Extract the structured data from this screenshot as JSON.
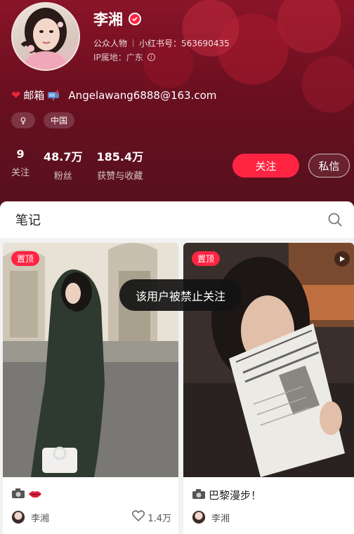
{
  "profile": {
    "name": "李湘",
    "category": "公众人物",
    "id_label": "小红书号：563690435",
    "ip_label": "IP属地：广东",
    "bio_text": "邮箱",
    "email": "Angelawang6888@163.com",
    "tags": [
      "♀",
      "中国"
    ]
  },
  "stats": [
    {
      "value": "9",
      "label": "关注"
    },
    {
      "value": "48.7万",
      "label": "粉丝"
    },
    {
      "value": "185.4万",
      "label": "获赞与收藏"
    }
  ],
  "actions": {
    "follow": "关注",
    "message": "私信"
  },
  "notes": {
    "section_title": "笔记",
    "cards": [
      {
        "pin": "置顶",
        "title": "",
        "author": "李湘",
        "likes": "1.4万"
      },
      {
        "pin": "置顶",
        "title": "巴黎漫步！",
        "author": "李湘",
        "likes": ""
      }
    ]
  },
  "toast": "该用户被禁止关注",
  "colors": {
    "accent": "#ff2442",
    "header_bg": "#6a0f20"
  },
  "icons": [
    "verified-icon",
    "info-icon",
    "heart-emoji",
    "mailbox-emoji",
    "search-icon",
    "video-play-icon",
    "camera-emoji",
    "lips-emoji",
    "heart-outline-icon"
  ]
}
